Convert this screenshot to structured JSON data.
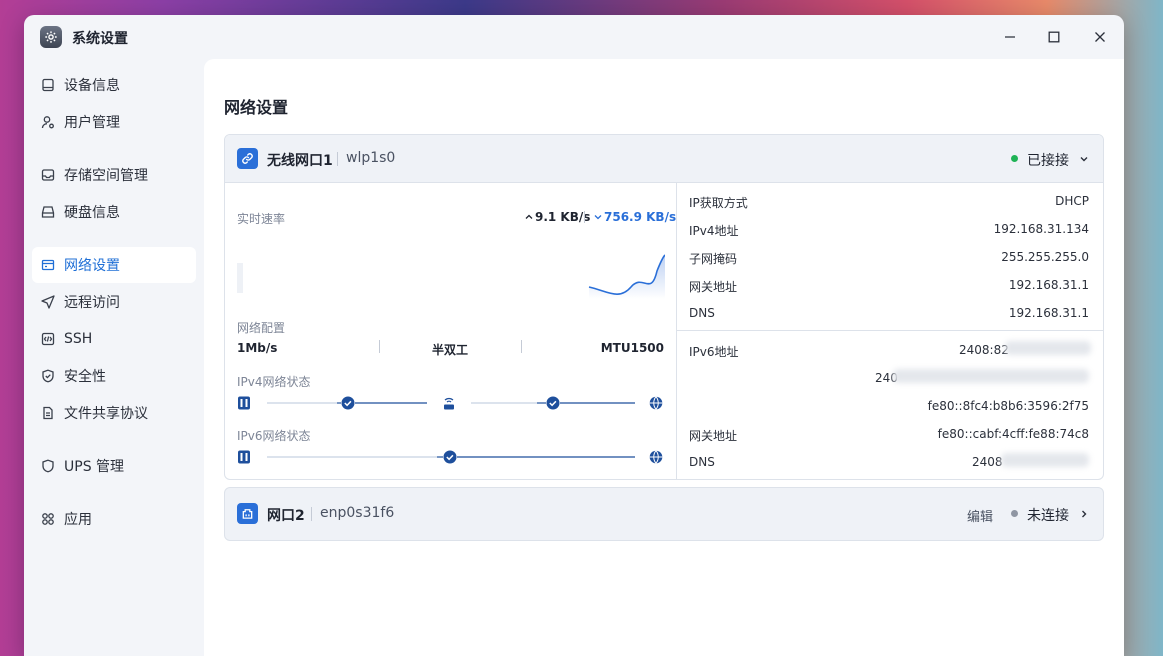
{
  "window": {
    "title": "系统设置"
  },
  "sidebar": {
    "items": [
      {
        "label": "设备信息",
        "icon": "device-icon"
      },
      {
        "label": "用户管理",
        "icon": "user-icon"
      },
      {
        "label": "存储空间管理",
        "icon": "storage-icon"
      },
      {
        "label": "硬盘信息",
        "icon": "disk-icon"
      },
      {
        "label": "网络设置",
        "icon": "network-icon",
        "active": true
      },
      {
        "label": "远程访问",
        "icon": "send-icon"
      },
      {
        "label": "SSH",
        "icon": "code-icon"
      },
      {
        "label": "安全性",
        "icon": "shield-icon"
      },
      {
        "label": "文件共享协议",
        "icon": "document-icon"
      },
      {
        "label": "UPS 管理",
        "icon": "ups-icon"
      },
      {
        "label": "应用",
        "icon": "apps-icon"
      }
    ]
  },
  "main": {
    "title": "网络设置",
    "interfaces": [
      {
        "name": "无线网口1",
        "device": "wlp1s0",
        "status": "已接接",
        "status_color": "#1fb356",
        "speed": {
          "label": "实时速率",
          "upload": "9.1 KB/s",
          "download": "756.9 KB/s"
        },
        "config": {
          "label": "网络配置",
          "speed": "1Mb/s",
          "duplex": "半双工",
          "mtu": "MTU1500"
        },
        "ipv4_status_label": "IPv4网络状态",
        "ipv6_status_label": "IPv6网络状态",
        "ipv4": [
          {
            "label": "IP获取方式",
            "value": "DHCP"
          },
          {
            "label": "IPv4地址",
            "value": "192.168.31.134"
          },
          {
            "label": "子网掩码",
            "value": "255.255.255.0"
          },
          {
            "label": "网关地址",
            "value": "192.168.31.1"
          },
          {
            "label": "DNS",
            "value": "192.168.31.1"
          }
        ],
        "ipv6": {
          "address_label": "IPv6地址",
          "address_1": "2408:82",
          "address_2": "240",
          "address_3": "fe80::8fc4:b8b6:3596:2f75",
          "gateway_label": "网关地址",
          "gateway": "fe80::cabf:4cff:fe88:74c8",
          "dns_label": "DNS",
          "dns": "2408"
        }
      },
      {
        "name": "网口2",
        "device": "enp0s31f6",
        "edit_label": "编辑",
        "status": "未连接",
        "status_color": "#8f96a3"
      }
    ]
  },
  "colors": {
    "accent": "#2a6fd8",
    "connected": "#1fb356",
    "disconnected": "#8f96a3",
    "progress": "#1e4f9c"
  }
}
